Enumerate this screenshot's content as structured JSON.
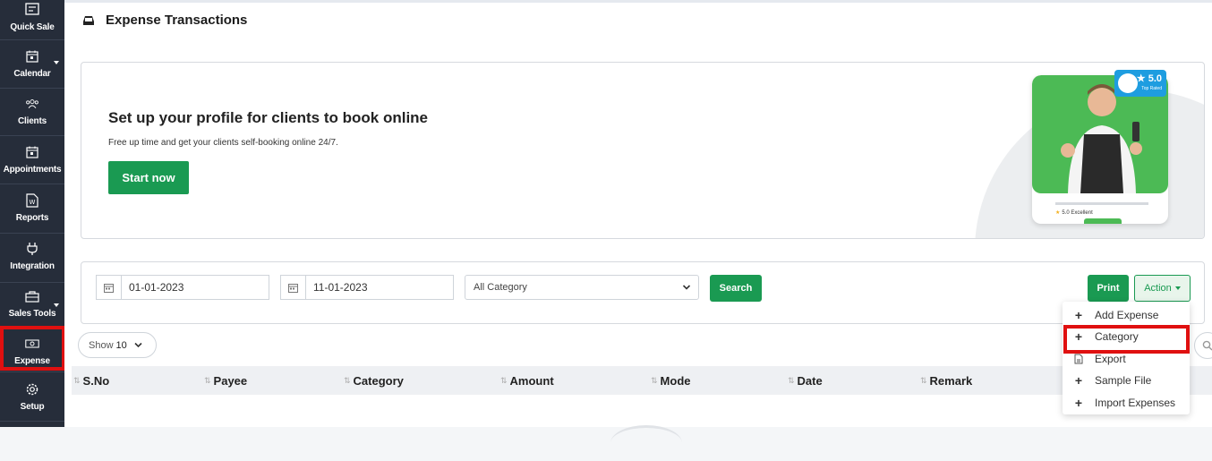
{
  "sidebar": {
    "items": [
      {
        "label": "Quick Sale",
        "icon": "register-icon"
      },
      {
        "label": "Calendar",
        "icon": "calendar-icon"
      },
      {
        "label": "Clients",
        "icon": "clients-icon"
      },
      {
        "label": "Appointments",
        "icon": "appointments-icon"
      },
      {
        "label": "Reports",
        "icon": "reports-icon"
      },
      {
        "label": "Integration",
        "icon": "plug-icon"
      },
      {
        "label": "Sales Tools",
        "icon": "briefcase-icon"
      },
      {
        "label": "Expense",
        "icon": "money-icon"
      },
      {
        "label": "Setup",
        "icon": "gear-icon"
      }
    ]
  },
  "header": {
    "title": "Expense Transactions",
    "icon": "inbox-icon"
  },
  "promo": {
    "heading": "Set up your profile for clients to book online",
    "subtext": "Free up time and get your clients self-booking online 24/7.",
    "cta": "Start now",
    "badge_rating": "5.0",
    "badge_sub": "Top Rated",
    "card_rating": "5.0 Excellent"
  },
  "filters": {
    "from_date": "01-01-2023",
    "to_date": "11-01-2023",
    "category_selected": "All Category",
    "search_label": "Search",
    "print_label": "Print",
    "action_label": "Action"
  },
  "table": {
    "show_label": "Show",
    "show_value": "10",
    "columns": [
      "S.No",
      "Payee",
      "Category",
      "Amount",
      "Mode",
      "Date",
      "Remark"
    ]
  },
  "action_menu": {
    "items": [
      {
        "label": "Add Expense",
        "icon": "plus-icon"
      },
      {
        "label": "Category",
        "icon": "plus-icon"
      },
      {
        "label": "Export",
        "icon": "file-icon"
      },
      {
        "label": "Sample File",
        "icon": "plus-icon"
      },
      {
        "label": "Import Expenses",
        "icon": "plus-icon"
      }
    ]
  },
  "colors": {
    "accent": "#1a9a52",
    "sidebar": "#262d3a",
    "highlight": "#e01010",
    "badge": "#1e9de0"
  }
}
